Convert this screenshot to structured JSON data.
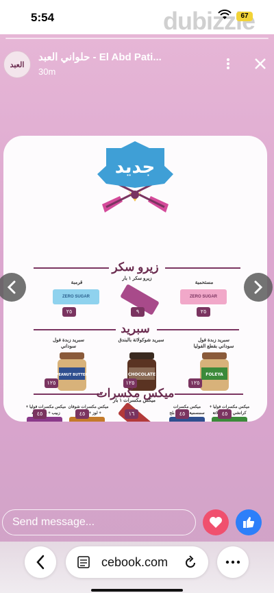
{
  "status": {
    "time": "5:54",
    "battery": "67",
    "watermark": "dubizzle"
  },
  "story": {
    "page_name": "حلواني العبد - El Abd Pati...",
    "avatar_text": "العبد",
    "post_time": "30m",
    "headline": "جديد",
    "sections": {
      "zero_sugar": "زيرو سكر",
      "spread": "سبريد",
      "mix_nuts": "ميكس مكسرات"
    },
    "zero_sugar_products": [
      {
        "label": "مستحمية",
        "price": "٢٥"
      },
      {
        "label": "زيرو سكر ١ بار",
        "price": "٩"
      },
      {
        "label": "قرمبة",
        "price": "٢٥"
      }
    ],
    "spread_products": [
      {
        "label": "سبريد زبدة فول سوداني بقطع الفوليا",
        "price": "١٢٥",
        "jar_text": "FOLEYA"
      },
      {
        "label": "سبريد شوكولاتة بالبندق",
        "price": "١٢٥",
        "jar_text": "CHOCOLATE"
      },
      {
        "label": "سبريد زبدة فول سوداني",
        "price": "١٢٥",
        "jar_text": "PEANUT BUTTER"
      }
    ],
    "mix_products": [
      {
        "label": "ميكس مكسرات فوليا + كرانشي + شوكولاتة",
        "price": "٤٥"
      },
      {
        "label": "ميكس مكسرات سمسمية + لوز + بلح مجدول",
        "price": "٤٥"
      },
      {
        "label": "ميكس مكسرات ١ بار",
        "price": "١٦"
      },
      {
        "label": "ميكس مكسرات شوفان + لوز + جوزهند",
        "price": "٤٥"
      },
      {
        "label": "ميكس مكسرات فوليا + زبيب + شوكولاتة",
        "price": "٤٥"
      }
    ],
    "zero_sugar_pack_text": "ZERO SUGAR"
  },
  "composer": {
    "placeholder": "Send message..."
  },
  "browser": {
    "url": "cebook.com"
  },
  "colors": {
    "story_bg": "#dca7cf",
    "section_color": "#6a2b4f",
    "heart": "#f0506e",
    "like": "#2d7ff9"
  }
}
